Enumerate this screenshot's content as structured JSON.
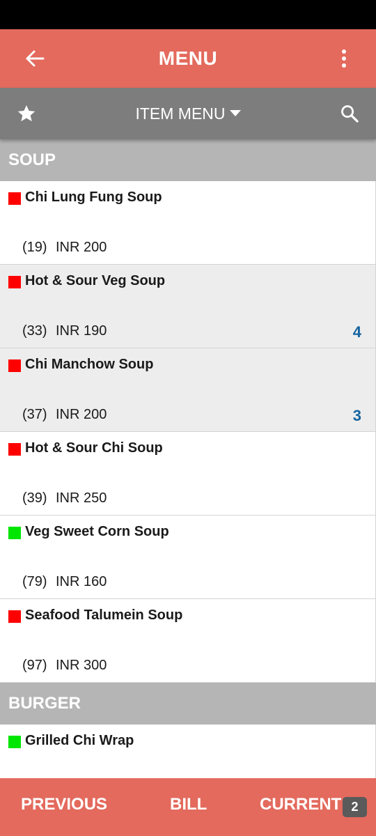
{
  "colors": {
    "app_bar": "#E36A5D",
    "sub_bar": "#7D7D7D",
    "category_bg": "#B5B5B5",
    "row_white": "#FFFFFF",
    "row_grey": "#EDEDED",
    "non_veg_marker": "#FF0000",
    "veg_marker": "#00E600",
    "qty_text": "#1565A0",
    "badge_bg": "#5A5A5A"
  },
  "header": {
    "title": "MENU",
    "back_icon": "arrow-left-icon",
    "more_icon": "more-vertical-icon"
  },
  "toolbar": {
    "favorite_icon": "star-icon",
    "dropdown_label": "ITEM MENU",
    "dropdown_icon": "caret-down-icon",
    "search_icon": "search-icon"
  },
  "categories": [
    {
      "name": "SOUP",
      "items": [
        {
          "name": "Chi Lung Fung Soup",
          "code": "(19)",
          "price": "INR 200",
          "qty": "",
          "marker": "non-veg",
          "highlighted": false
        },
        {
          "name": "Hot & Sour Veg Soup",
          "code": "(33)",
          "price": "INR 190",
          "qty": "4",
          "marker": "non-veg",
          "highlighted": true
        },
        {
          "name": "Chi Manchow Soup",
          "code": "(37)",
          "price": "INR 200",
          "qty": "3",
          "marker": "non-veg",
          "highlighted": true
        },
        {
          "name": "Hot & Sour Chi Soup",
          "code": "(39)",
          "price": "INR 250",
          "qty": "",
          "marker": "non-veg",
          "highlighted": false
        },
        {
          "name": "Veg Sweet Corn Soup",
          "code": "(79)",
          "price": "INR 160",
          "qty": "",
          "marker": "veg",
          "highlighted": false
        },
        {
          "name": "Seafood Talumein Soup",
          "code": "(97)",
          "price": "INR 300",
          "qty": "",
          "marker": "non-veg",
          "highlighted": false
        }
      ]
    },
    {
      "name": "BURGER",
      "items": [
        {
          "name": "Grilled Chi Wrap",
          "code": "",
          "price": "",
          "qty": "",
          "marker": "veg",
          "highlighted": false
        }
      ]
    }
  ],
  "bottom_nav": {
    "previous_label": "PREVIOUS",
    "bill_label": "BILL",
    "current_label": "CURRENT",
    "current_badge": "2"
  }
}
